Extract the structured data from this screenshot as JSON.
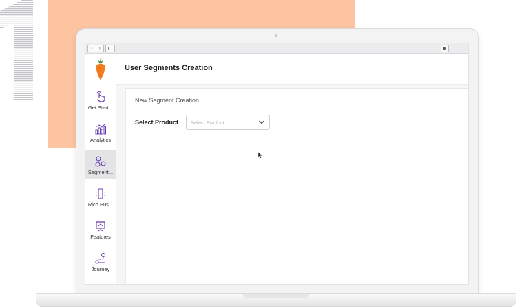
{
  "colors": {
    "accent_orange": "#fcc4a0",
    "icon_purple": "#6b3fb0",
    "carrot_orange": "#f47b20",
    "carrot_green": "#3c8a3a",
    "active_bg": "#e4e4e7"
  },
  "browser": {
    "back_icon": "‹",
    "forward_icon": "›"
  },
  "sidebar": {
    "items": [
      {
        "label": "Get Start...",
        "icon": "tap-hand-icon",
        "active": false
      },
      {
        "label": "Analytics",
        "icon": "bar-chart-icon",
        "active": false
      },
      {
        "label": "Segment...",
        "icon": "segment-nodes-icon",
        "active": true
      },
      {
        "label": "Rich Pus...",
        "icon": "phone-push-icon",
        "active": false
      },
      {
        "label": "Features",
        "icon": "presentation-board-icon",
        "active": false
      },
      {
        "label": "Journey",
        "icon": "journey-path-icon",
        "active": false
      }
    ]
  },
  "header": {
    "title": "User Segments Creation"
  },
  "form": {
    "card_title": "New Segment Creation",
    "select_label": "Select Product",
    "select_placeholder": "Select Product"
  }
}
